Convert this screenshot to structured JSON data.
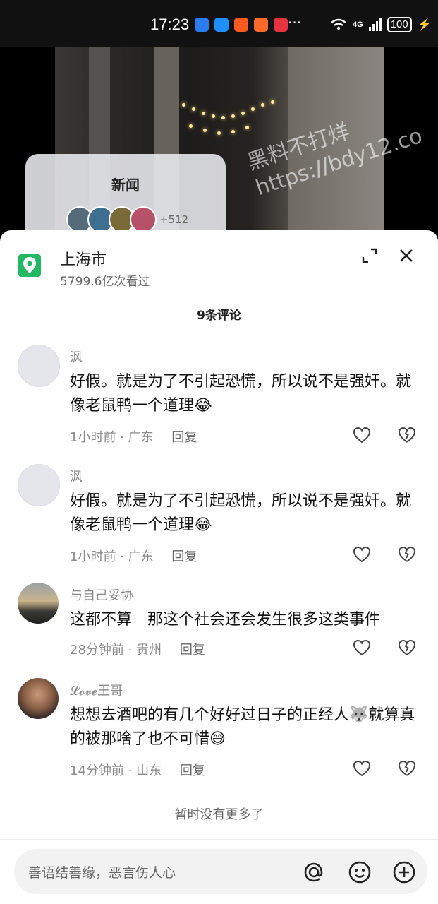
{
  "status_bar": {
    "time": "17:23",
    "network": "4G",
    "battery": "100"
  },
  "watermark": {
    "line1": "黑料不打烊",
    "line2": "https://bdy12.co"
  },
  "news_card": {
    "title": "新闻",
    "extra_count": "+512"
  },
  "location": {
    "name": "上海市",
    "views": "5799.6亿次看过"
  },
  "comments_title": "9条评论",
  "comments": [
    {
      "name": "沨",
      "text": "好假。就是为了不引起恐慌，所以说不是强奸。就像老鼠鸭一个道理😂",
      "time": "1小时前 · 广东",
      "reply": "回复"
    },
    {
      "name": "沨",
      "text": "好假。就是为了不引起恐慌，所以说不是强奸。就像老鼠鸭一个道理😂",
      "time": "1小时前 · 广东",
      "reply": "回复"
    },
    {
      "name": "与自己妥协",
      "text": "这都不算　那这个社会还会发生很多这类事件",
      "time": "28分钟前 · 贵州",
      "reply": "回复"
    },
    {
      "name": "𝓛𝓸𝓿𝓮王哥",
      "text": "想想去酒吧的有几个好好过日子的正经人🐺就算真的被那啥了也不可惜😅",
      "time": "14分钟前 · 山东",
      "reply": "回复"
    }
  ],
  "no_more": "暂时没有更多了",
  "input": {
    "placeholder": "善语结善缘，恶言伤人心"
  },
  "colors": {
    "location_icon": "#25b864"
  }
}
